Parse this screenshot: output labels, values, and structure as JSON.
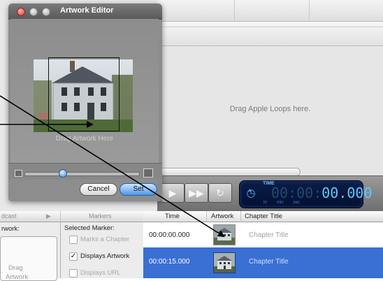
{
  "editor": {
    "title": "Artwork Editor",
    "drop_hint": "Drag Artwork Here",
    "cancel_label": "Cancel",
    "set_label": "Set"
  },
  "loops_area": {
    "hint": "Drag Apple Loops here."
  },
  "transport": {
    "lcd_mode": "TIME",
    "time": "00:00:00.000",
    "time_dim": "00:00:",
    "time_bright": "00.000",
    "units": "hr min sec"
  },
  "bottom": {
    "tabs": [
      {
        "label": "dcast"
      },
      {
        "label": "Markers"
      }
    ],
    "artwork_label": "rwork:",
    "artwork_hint_1": "Drag",
    "artwork_hint_2": "Artwork",
    "selected_marker": "Selected Marker:",
    "options": [
      {
        "label": "Marks a Chapter",
        "checked": false,
        "enabled": false
      },
      {
        "label": "Displays Artwork",
        "checked": true,
        "enabled": true
      },
      {
        "label": "Displays URL",
        "checked": false,
        "enabled": false
      }
    ],
    "columns": [
      "Time",
      "Artwork",
      "Chapter Title"
    ],
    "rows": [
      {
        "time": "00:00:00.000",
        "title": "Chapter Title",
        "selected": false
      },
      {
        "time": "00:00:15.000",
        "title": "Chapter Title",
        "selected": true
      }
    ]
  },
  "colors": {
    "selection": "#3a6fd4",
    "lcd_digits": "#5fc8ff",
    "close_light": "#e0453d",
    "inactive_light": "#b6b6b6"
  }
}
